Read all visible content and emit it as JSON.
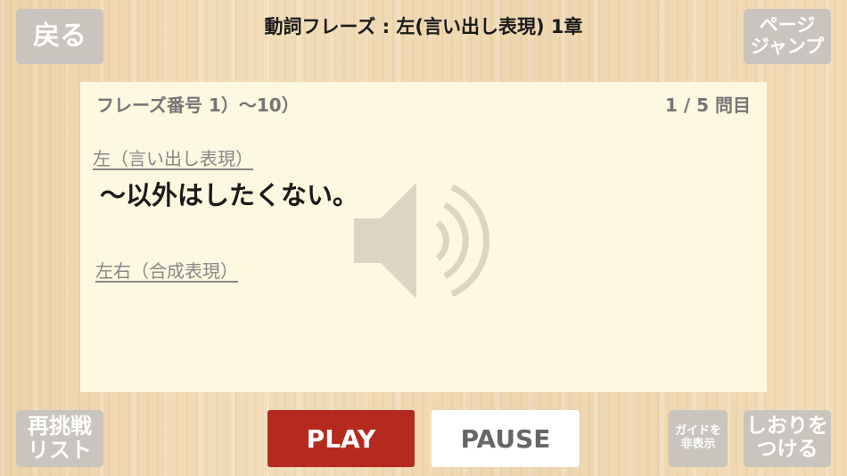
{
  "header": {
    "back_label": "戻る",
    "title": "動詞フレーズ : 左(言い出し表現) 1章",
    "page_jump_label_line1": "ページ",
    "page_jump_label_line2": "ジャンプ"
  },
  "card": {
    "range_label": "フレーズ番号 1）〜10）",
    "counter": "1 / 5 問目",
    "phrase_left": "左（言い出し表現）",
    "sentence": "〜以外はしたくない。",
    "phrase_leftright": "左右（合成表現）",
    "speaker_icon": "speaker-icon"
  },
  "footer": {
    "retry_list_line1": "再挑戦",
    "retry_list_line2": "リスト",
    "play_label": "PLAY",
    "pause_label": "PAUSE",
    "guide_line1": "ガイドを",
    "guide_line2": "非表示",
    "bookmark_line1": "しおりを",
    "bookmark_line2": "つける"
  },
  "colors": {
    "play": "#b52a1f",
    "card": "#fdf8e0",
    "gray_button": "#c9c4bd"
  }
}
